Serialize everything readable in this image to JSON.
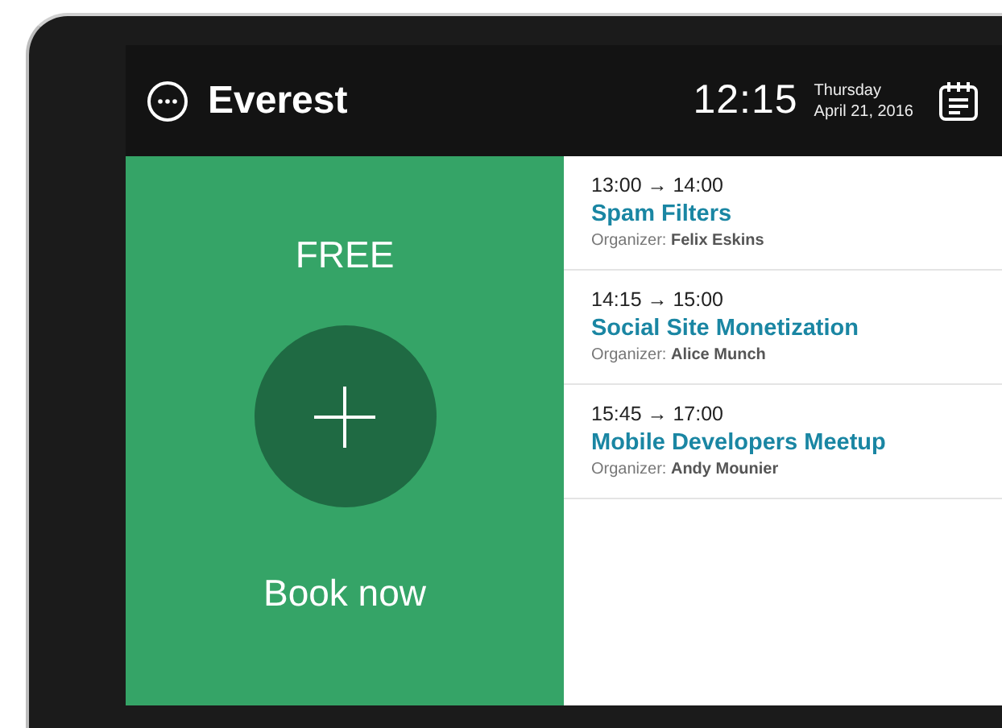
{
  "header": {
    "room": "Everest",
    "time": "12:15",
    "weekday": "Thursday",
    "date": "April 21, 2016"
  },
  "status": {
    "label": "FREE",
    "action": "Book now"
  },
  "meetings": [
    {
      "time": "13:00 → 14:00",
      "title": "Spam Filters",
      "organizer": "Organizer: **Felix Eskins**"
    },
    {
      "time": "14:15 → 15:00",
      "title": "Social Site Monetization",
      "organizer": "Organizer: **Alice Munch**"
    },
    {
      "time": "15:45 → 17:00",
      "title": "Mobile Developers Meetup",
      "organizer": "Organizer: **Andy Mounier**"
    }
  ]
}
